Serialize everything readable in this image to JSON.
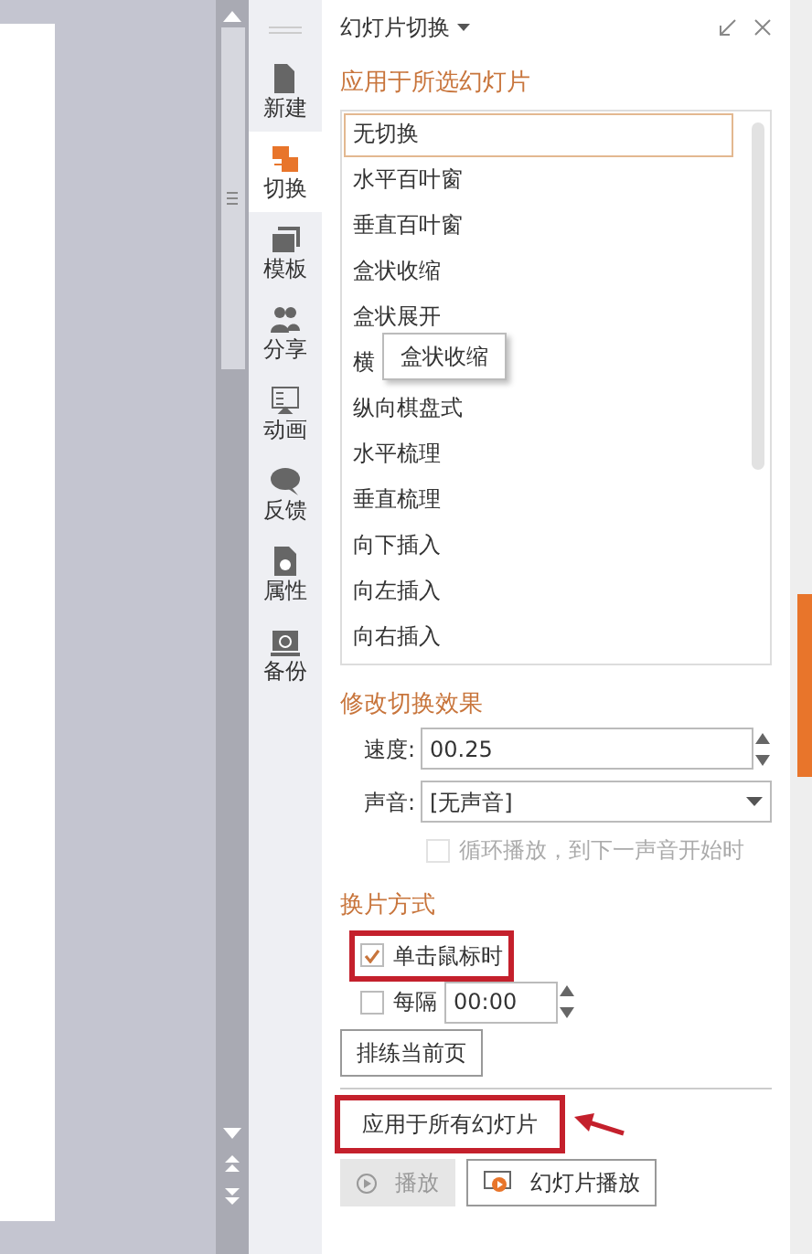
{
  "sidebar": {
    "items": [
      {
        "label": "新建",
        "selected": false
      },
      {
        "label": "切换",
        "selected": true
      },
      {
        "label": "模板",
        "selected": false
      },
      {
        "label": "分享",
        "selected": false
      },
      {
        "label": "动画",
        "selected": false
      },
      {
        "label": "反馈",
        "selected": false
      },
      {
        "label": "属性",
        "selected": false
      },
      {
        "label": "备份",
        "selected": false
      }
    ]
  },
  "panel": {
    "title": "幻灯片切换",
    "transitions": {
      "heading": "应用于所选幻灯片",
      "items": [
        {
          "label": "无切换",
          "selected": true
        },
        {
          "label": "水平百叶窗",
          "selected": false
        },
        {
          "label": "垂直百叶窗",
          "selected": false
        },
        {
          "label": "盒状收缩",
          "selected": false
        },
        {
          "label": "盒状展开",
          "selected": false
        },
        {
          "label": "横",
          "selected": false,
          "tooltip": "盒状收缩"
        },
        {
          "label": "纵向棋盘式",
          "selected": false
        },
        {
          "label": "水平梳理",
          "selected": false
        },
        {
          "label": "垂直梳理",
          "selected": false
        },
        {
          "label": "向下插入",
          "selected": false
        },
        {
          "label": "向左插入",
          "selected": false
        },
        {
          "label": "向右插入",
          "selected": false
        }
      ]
    },
    "effects": {
      "heading": "修改切换效果",
      "speed": {
        "label": "速度:",
        "value": "00.25"
      },
      "sound": {
        "label": "声音:",
        "value": "[无声音]"
      },
      "loop": {
        "label": "循环播放，到下一声音开始时",
        "checked": false,
        "disabled": true
      }
    },
    "advance": {
      "heading": "换片方式",
      "on_click": {
        "label": "单击鼠标时",
        "checked": true,
        "annotated": true
      },
      "every": {
        "label": "每隔",
        "checked": false,
        "value": "00:00"
      },
      "rehearse": "排练当前页"
    },
    "apply_all": {
      "label": "应用于所有幻灯片",
      "annotated": true
    },
    "play": {
      "label": "播放",
      "disabled": true
    },
    "slideshow": {
      "label": "幻灯片播放",
      "disabled": false
    }
  }
}
